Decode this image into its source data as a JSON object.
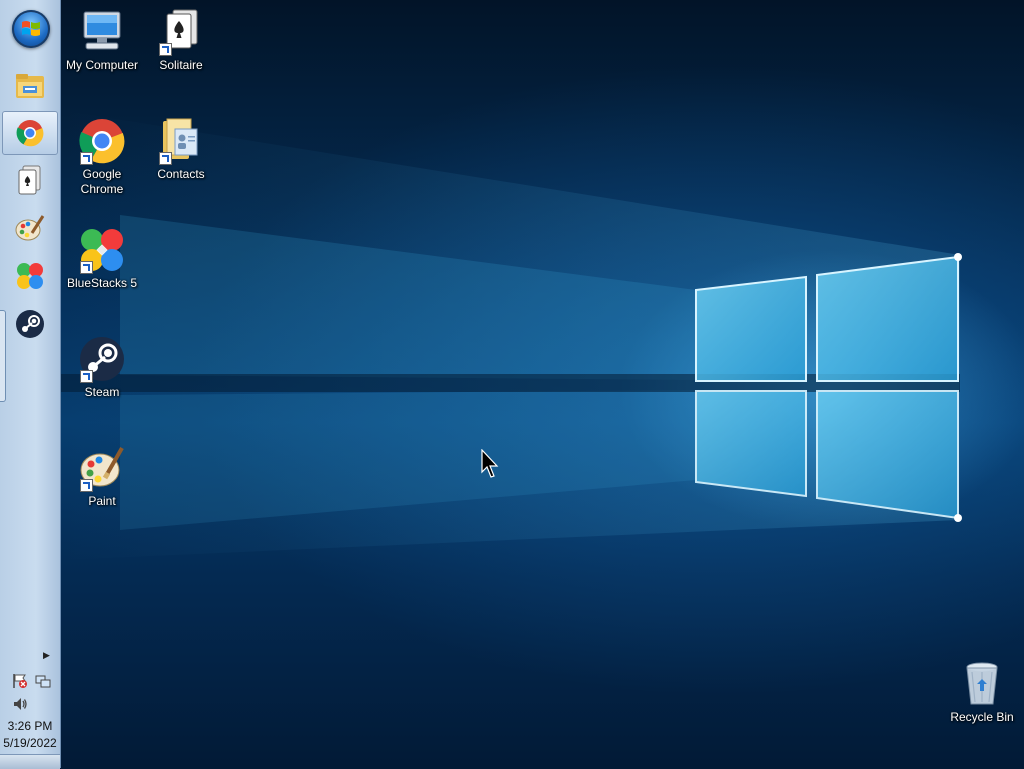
{
  "taskbar": {
    "start_icon": "windows-orb-icon",
    "pinned": [
      {
        "name": "file-explorer",
        "icon": "folder-icon",
        "active": false
      },
      {
        "name": "google-chrome",
        "icon": "chrome-icon",
        "active": true
      },
      {
        "name": "solitaire",
        "icon": "solitaire-icon",
        "active": false
      },
      {
        "name": "paint",
        "icon": "paint-palette-icon",
        "active": false
      },
      {
        "name": "bluestacks",
        "icon": "bluestacks-icon",
        "active": false
      },
      {
        "name": "steam",
        "icon": "steam-icon",
        "active": false
      }
    ],
    "tray": {
      "expand_icon": "tray-expand-arrow-icon",
      "icons": [
        "action-center-flag-icon",
        "network-icon",
        "volume-icon"
      ],
      "time": "3:26 PM",
      "date": "5/19/2022"
    }
  },
  "desktop": {
    "icons": [
      {
        "label": "My Computer",
        "icon": "computer-icon"
      },
      {
        "label": "Solitaire",
        "icon": "solitaire-icon"
      },
      {
        "label": "Google Chrome",
        "icon": "chrome-icon"
      },
      {
        "label": "Contacts",
        "icon": "contacts-folder-icon"
      },
      {
        "label": "BlueStacks 5",
        "icon": "bluestacks-icon"
      },
      {
        "label": "Steam",
        "icon": "steam-icon"
      },
      {
        "label": "Paint",
        "icon": "paint-palette-icon"
      },
      {
        "label": "Recycle Bin",
        "icon": "recycle-bin-icon"
      }
    ]
  },
  "colors": {
    "wallpaper_dark": "#021a36",
    "wallpaper_light": "#4fc3f0",
    "taskbar": "#c9dcef"
  }
}
